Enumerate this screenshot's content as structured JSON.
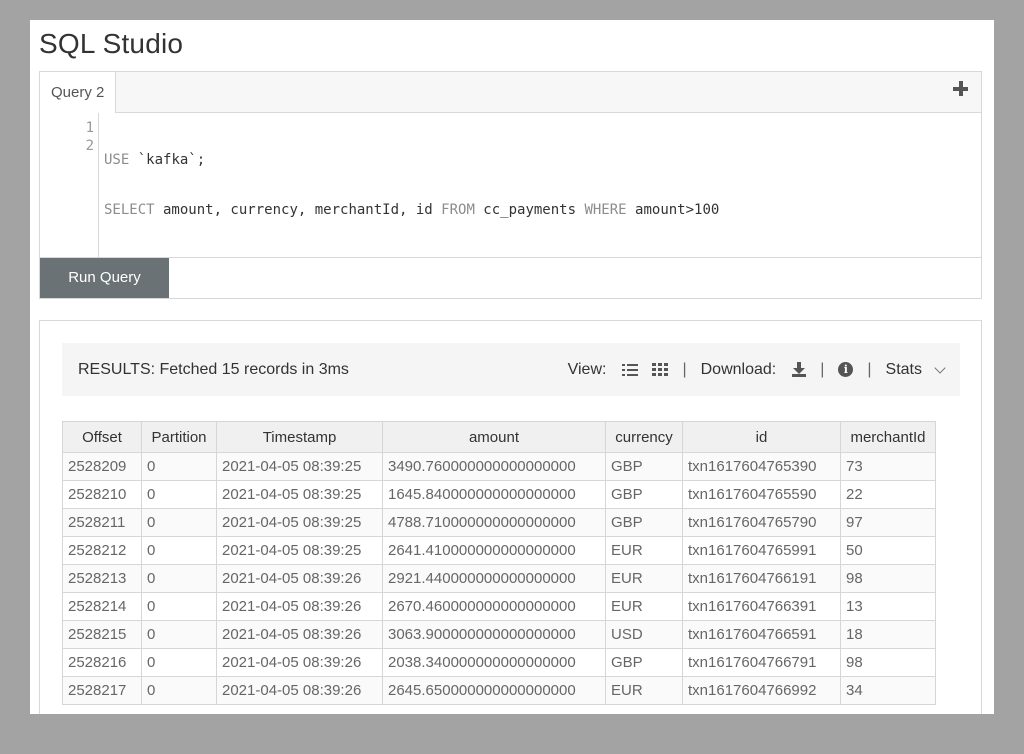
{
  "app": {
    "title": "SQL Studio"
  },
  "editor": {
    "tabs": [
      {
        "label": "Query 2"
      }
    ],
    "add_tab_icon": "plus-icon",
    "lines": [
      {
        "number": "1",
        "tokens": [
          {
            "text": "USE",
            "kw": true
          },
          {
            "text": " `kafka`;",
            "kw": false
          }
        ]
      },
      {
        "number": "2",
        "tokens": [
          {
            "text": "SELECT",
            "kw": true
          },
          {
            "text": " amount, currency, merchantId, id ",
            "kw": false
          },
          {
            "text": "FROM",
            "kw": true
          },
          {
            "text": " cc_payments ",
            "kw": false
          },
          {
            "text": "WHERE",
            "kw": true
          },
          {
            "text": " amount>100",
            "kw": false
          }
        ]
      }
    ],
    "run_label": "Run Query"
  },
  "results": {
    "summary": "RESULTS: Fetched 15 records in 3ms",
    "view_label": "View:",
    "download_label": "Download:",
    "stats_label": "Stats",
    "separator": "|",
    "columns": [
      "Offset",
      "Partition",
      "Timestamp",
      "amount",
      "currency",
      "id",
      "merchantId"
    ],
    "rows": [
      [
        "2528209",
        "0",
        "2021-04-05 08:39:25",
        "3490.760000000000000000",
        "GBP",
        "txn1617604765390",
        "73"
      ],
      [
        "2528210",
        "0",
        "2021-04-05 08:39:25",
        "1645.840000000000000000",
        "GBP",
        "txn1617604765590",
        "22"
      ],
      [
        "2528211",
        "0",
        "2021-04-05 08:39:25",
        "4788.710000000000000000",
        "GBP",
        "txn1617604765790",
        "97"
      ],
      [
        "2528212",
        "0",
        "2021-04-05 08:39:25",
        "2641.410000000000000000",
        "EUR",
        "txn1617604765991",
        "50"
      ],
      [
        "2528213",
        "0",
        "2021-04-05 08:39:26",
        "2921.440000000000000000",
        "EUR",
        "txn1617604766191",
        "98"
      ],
      [
        "2528214",
        "0",
        "2021-04-05 08:39:26",
        "2670.460000000000000000",
        "EUR",
        "txn1617604766391",
        "13"
      ],
      [
        "2528215",
        "0",
        "2021-04-05 08:39:26",
        "3063.900000000000000000",
        "USD",
        "txn1617604766591",
        "18"
      ],
      [
        "2528216",
        "0",
        "2021-04-05 08:39:26",
        "2038.340000000000000000",
        "GBP",
        "txn1617604766791",
        "98"
      ],
      [
        "2528217",
        "0",
        "2021-04-05 08:39:26",
        "2645.650000000000000000",
        "EUR",
        "txn1617604766992",
        "34"
      ]
    ]
  },
  "colors": {
    "background": "#a3a3a3",
    "run_button": "#6b7275",
    "keyword": "#8c8c8c",
    "header_cell": "#f0f0f0"
  }
}
